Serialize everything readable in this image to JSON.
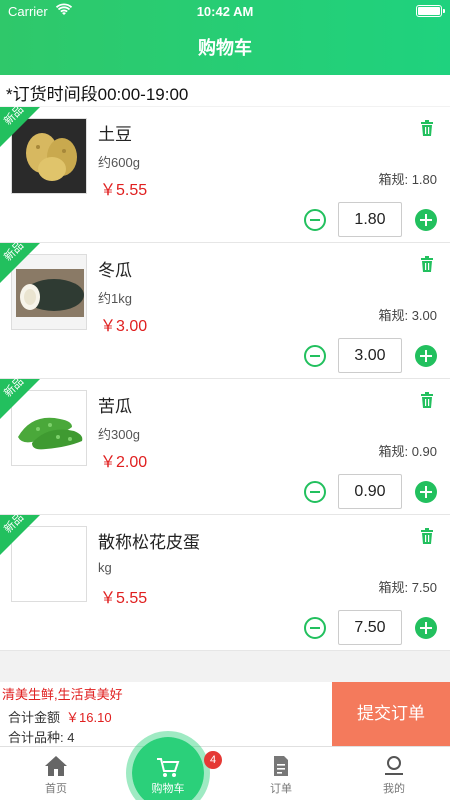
{
  "status": {
    "carrier": "Carrier",
    "time": "10:42 AM"
  },
  "header": {
    "title": "购物车"
  },
  "notice": "*订货时间段00:00-19:00",
  "items": [
    {
      "badge": "新品",
      "name": "土豆",
      "spec": "约600g",
      "price": "￥5.55",
      "box_rule": "箱规: 1.80",
      "qty": "1.80",
      "image": "potato"
    },
    {
      "badge": "新品",
      "name": "冬瓜",
      "spec": "约1kg",
      "price": "￥3.00",
      "box_rule": "箱规: 3.00",
      "qty": "3.00",
      "image": "winter-melon"
    },
    {
      "badge": "新品",
      "name": "苦瓜",
      "spec": "约300g",
      "price": "￥2.00",
      "box_rule": "箱规: 0.90",
      "qty": "0.90",
      "image": "bitter-melon"
    },
    {
      "badge": "新品",
      "name": "散称松花皮蛋",
      "spec": "kg",
      "price": "￥5.55",
      "box_rule": "箱规: 7.50",
      "qty": "7.50",
      "image": ""
    }
  ],
  "summary": {
    "slogan": "清美生鲜,生活真美好",
    "total_label": "合计金额",
    "total_amount": "￥16.10",
    "kinds_label": "合计品种:",
    "kinds_value": "4",
    "submit_label": "提交订单"
  },
  "tabbar": {
    "home": "首页",
    "cart": "购物车",
    "cart_badge": "4",
    "orders": "订单",
    "mine": "我的"
  },
  "colors": {
    "accent": "#22c05e",
    "price": "#e02020",
    "submit": "#f47a5c"
  }
}
